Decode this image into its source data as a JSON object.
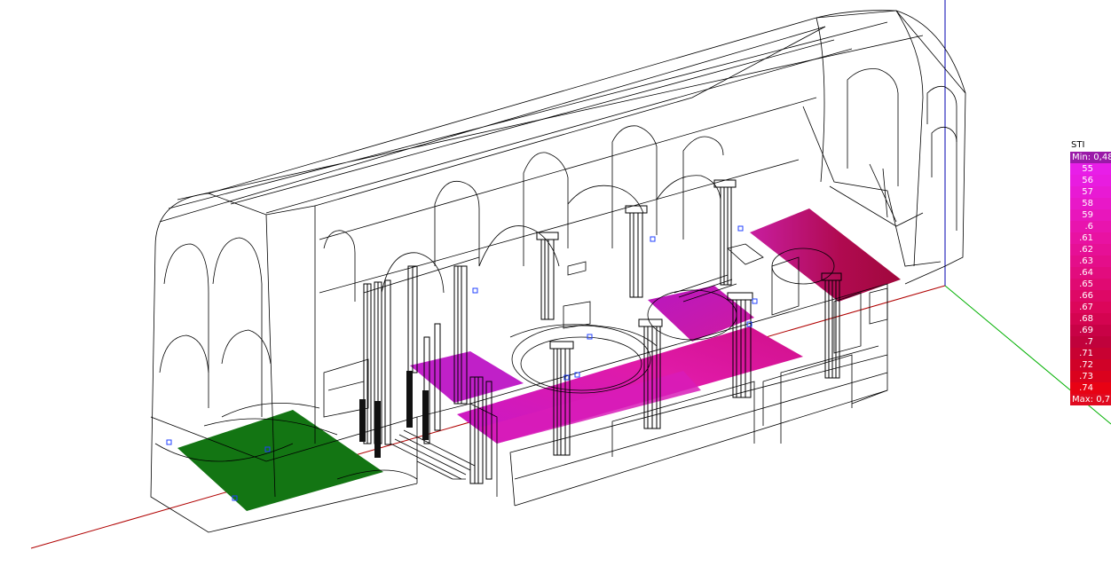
{
  "legend": {
    "title": "STI",
    "min_label": "Min: 0,48",
    "max_label": "Max: 0,7",
    "entries": [
      {
        "label": "55",
        "color": "#e81ee8"
      },
      {
        "label": "56",
        "color": "#e81ce0"
      },
      {
        "label": "57",
        "color": "#e81ad4"
      },
      {
        "label": "58",
        "color": "#e818c8"
      },
      {
        "label": "59",
        "color": "#e816bc"
      },
      {
        "label": ".6",
        "color": "#e814ae"
      },
      {
        "label": ".61",
        "color": "#e812a2"
      },
      {
        "label": ".62",
        "color": "#e61096"
      },
      {
        "label": ".63",
        "color": "#e40e8a"
      },
      {
        "label": ".64",
        "color": "#e20c7e"
      },
      {
        "label": ".65",
        "color": "#e00a72"
      },
      {
        "label": ".66",
        "color": "#de0866"
      },
      {
        "label": ".67",
        "color": "#dc065a"
      },
      {
        "label": ".68",
        "color": "#d40450"
      },
      {
        "label": ".69",
        "color": "#c80246"
      },
      {
        "label": ".7",
        "color": "#c0023c"
      },
      {
        "label": ".71",
        "color": "#c80232"
      },
      {
        "label": ".72",
        "color": "#d00228"
      },
      {
        "label": ".73",
        "color": "#da021e"
      },
      {
        "label": ".74",
        "color": "#e80214"
      }
    ],
    "min_color": "#9a1aa8",
    "max_color": "#e00a20"
  },
  "colors": {
    "wire": "#000000",
    "receiver_area_green": "#137513",
    "axis_x": "#b00000",
    "axis_y": "#00b000",
    "axis_z": "#0000b0",
    "marker": "#2040ff"
  }
}
